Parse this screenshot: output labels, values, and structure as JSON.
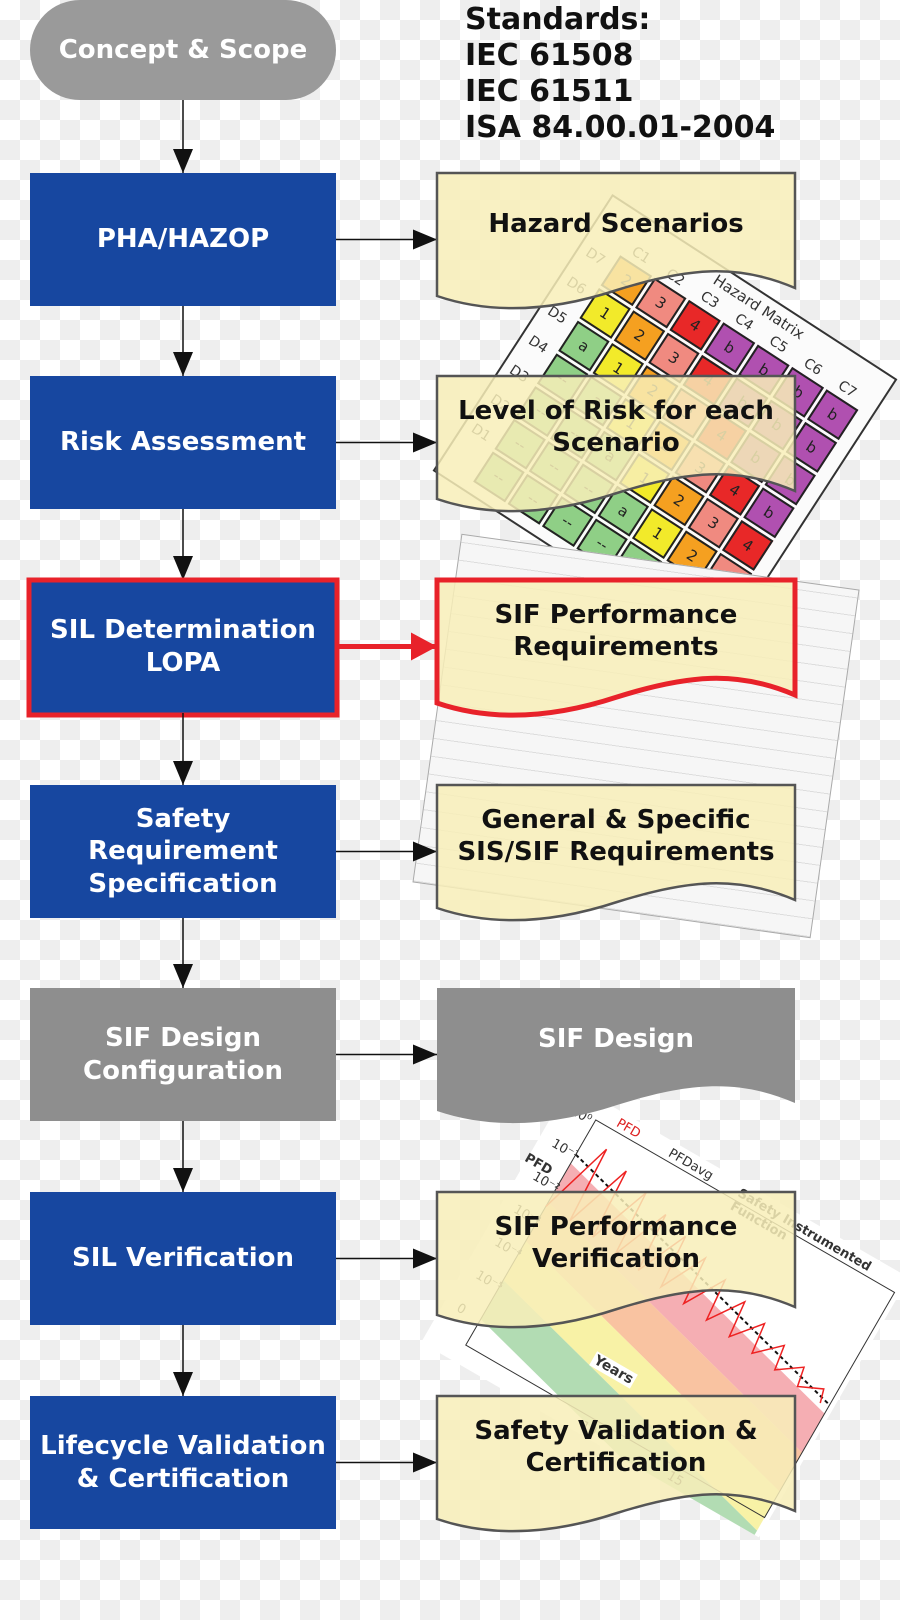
{
  "standards": {
    "lines": [
      "Standards:",
      "IEC 61508",
      "IEC 61511",
      "ISA 84.00.01-2004"
    ]
  },
  "colors": {
    "process_blue": "#1747a0",
    "inactive_gray": "#8e8e8e",
    "highlight_red": "#e8222a",
    "document_fill": "#f8efb8",
    "pill_gray": "#9a9a9a"
  },
  "start": {
    "label": "Concept & Scope"
  },
  "steps": [
    {
      "label": "PHA/HAZOP",
      "state": "normal",
      "output": "Hazard Scenarios"
    },
    {
      "label": "Risk Assessment",
      "state": "normal",
      "output": "Level of Risk for each Scenario"
    },
    {
      "label": "SIL Determination LOPA",
      "state": "highlighted",
      "output": "SIF Performance Requirements"
    },
    {
      "label": "Safety Requirement Specification",
      "state": "normal",
      "output": "General & Specific SIS/SIF Requirements"
    },
    {
      "label": "SIF Design Configuration",
      "state": "inactive",
      "output": "SIF Design"
    },
    {
      "label": "SIL Verification",
      "state": "normal",
      "output": "SIF Performance Verification"
    },
    {
      "label": "Lifecycle Validation & Certification",
      "state": "normal",
      "output": "Safety Validation & Certification"
    }
  ],
  "hazard_matrix": {
    "title": "Hazard Matrix",
    "columns": [
      "C1",
      "C2",
      "C3",
      "C4",
      "C5",
      "C6",
      "C7"
    ],
    "rows": [
      "D7",
      "D6",
      "D5",
      "D4",
      "D3",
      "D2",
      "D1"
    ],
    "cells": [
      [
        "2",
        "3",
        "4",
        "b",
        "b",
        "b",
        "b"
      ],
      [
        "1",
        "2",
        "3",
        "4",
        "b",
        "b",
        "b"
      ],
      [
        "a",
        "1",
        "2",
        "3",
        "4",
        "b",
        "b"
      ],
      [
        "--",
        "a",
        "1",
        "2",
        "3",
        "4",
        "b"
      ],
      [
        "--",
        "--",
        "a",
        "1",
        "2",
        "3",
        "4"
      ],
      [
        "--",
        "--",
        "--",
        "a",
        "1",
        "2",
        "3"
      ],
      [
        "--",
        "--",
        "--",
        "--",
        "a",
        "1",
        "2"
      ]
    ],
    "cell_colors": {
      "--": "#8fcf86",
      "a": "#8fcf86",
      "1": "#f2ea2a",
      "2": "#f5a020",
      "3": "#f08a80",
      "4": "#e82828",
      "b": "#b050b0"
    }
  },
  "pfd_chart": {
    "title": "Safety Instrumented Function",
    "legend": [
      "PFD",
      "PFDavg"
    ],
    "ylabel": "PFD",
    "xlabel": "Years",
    "yticks": [
      "10⁰",
      "10⁻¹",
      "10⁻²",
      "10⁻³",
      "10⁻⁴",
      "10⁻⁵",
      "0"
    ],
    "xticks": [
      "10",
      "15"
    ]
  }
}
